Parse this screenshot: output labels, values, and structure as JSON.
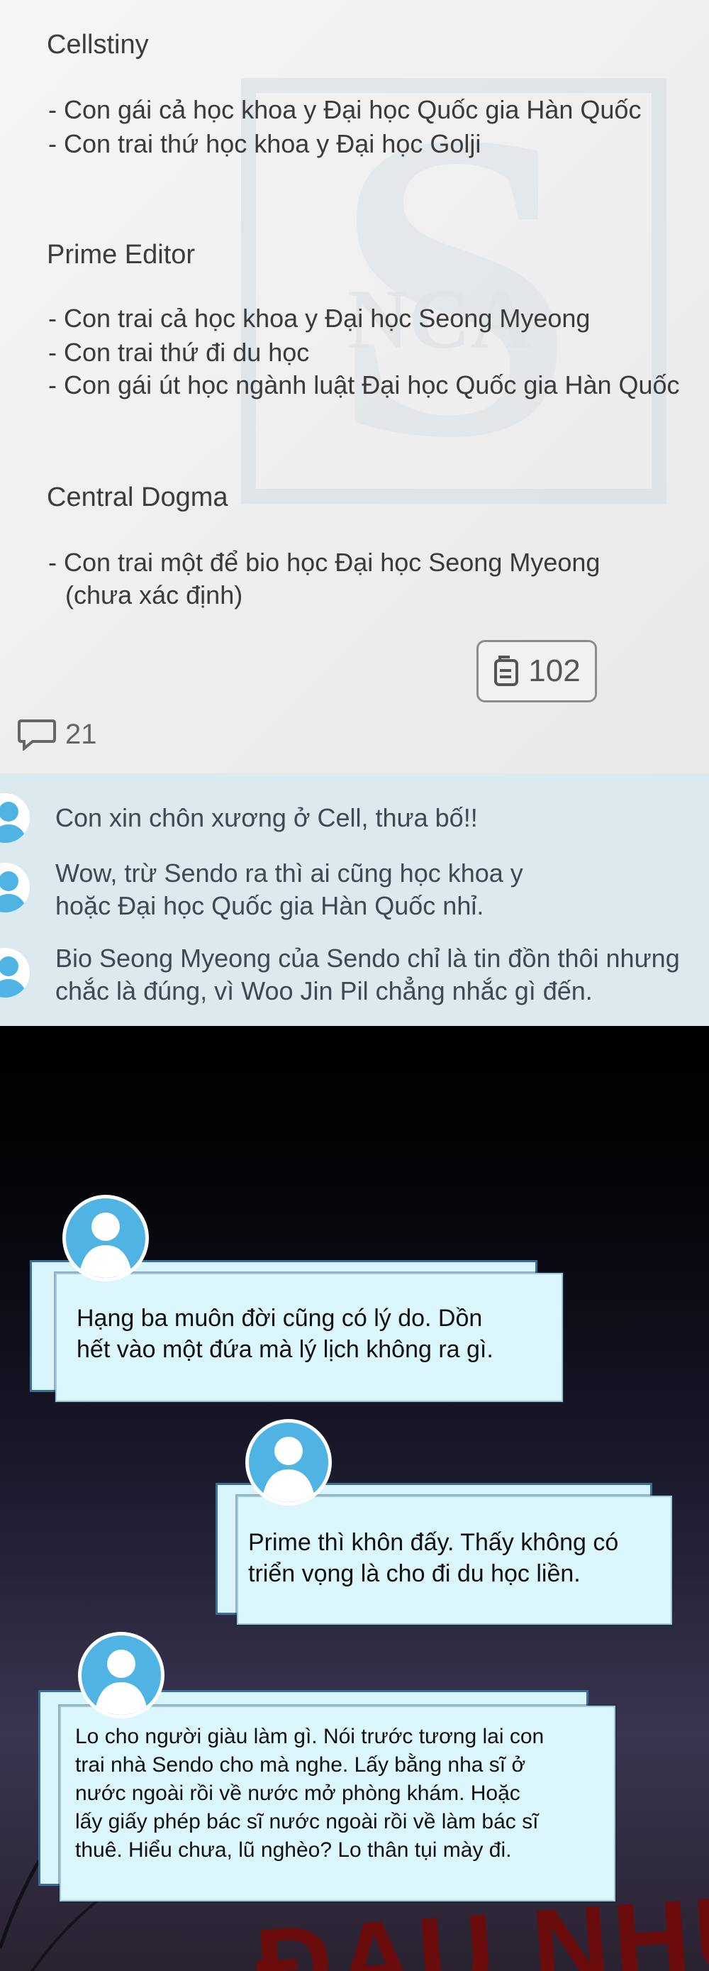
{
  "sections": [
    {
      "title": "Cellstiny",
      "lines": [
        "- Con gái cả học khoa y Đại học Quốc gia Hàn Quốc",
        "- Con trai thứ học khoa y Đại học Golji"
      ]
    },
    {
      "title": "Prime Editor",
      "lines": [
        "- Con trai cả học khoa y Đại học Seong Myeong",
        "- Con trai thứ đi du học",
        "- Con gái út học ngành luật Đại học Quốc gia Hàn Quốc"
      ]
    },
    {
      "title": "Central Dogma",
      "lines": [
        "- Con trai một để bio học Đại học Seong Myeong",
        "(chưa xác định)"
      ]
    }
  ],
  "like_count": "102",
  "comment_count": "21",
  "comments": [
    [
      "Con xin chôn xương ở Cell, thưa bố!!"
    ],
    [
      "Wow, trừ Sendo ra thì ai cũng học khoa y",
      "hoặc Đại học Quốc gia Hàn Quốc nhỉ."
    ],
    [
      "Bio Seong Myeong của Sendo chỉ là tin đồn thôi nhưng",
      "chắc là đúng, vì Woo Jin Pil chẳng nhắc gì đến."
    ]
  ],
  "bubbles": [
    [
      "Hạng ba muôn đời cũng có lý do. Dồn",
      "hết vào một đứa mà lý lịch không ra gì."
    ],
    [
      "Prime thì khôn đấy. Thấy không có",
      "triển vọng là cho đi du học liền."
    ],
    [
      "Lo cho người giàu làm gì. Nói trước tương lai con",
      "trai nhà Sendo cho mà nghe. Lấy bằng nha sĩ ở",
      "nước ngoài rồi về nước mở phòng khám. Hoặc",
      "lấy giấy phép bác sĩ nước ngoài rồi về làm bác sĩ",
      "thuê. Hiểu chưa, lũ nghèo? Lo thân tụi mày đi."
    ]
  ],
  "sfx": "ĐAU NHỨC",
  "icons": {
    "like": "like-icon",
    "comment": "comment-bubble-icon",
    "avatar": "user-avatar-icon",
    "watermark": "nca-watermark"
  },
  "colors": {
    "comment_panel": "#dce9ee",
    "avatar_blue": "#4fb3e4",
    "bubble_fill": "#dcf6fd",
    "bubble_border": "#3b6e9a"
  }
}
